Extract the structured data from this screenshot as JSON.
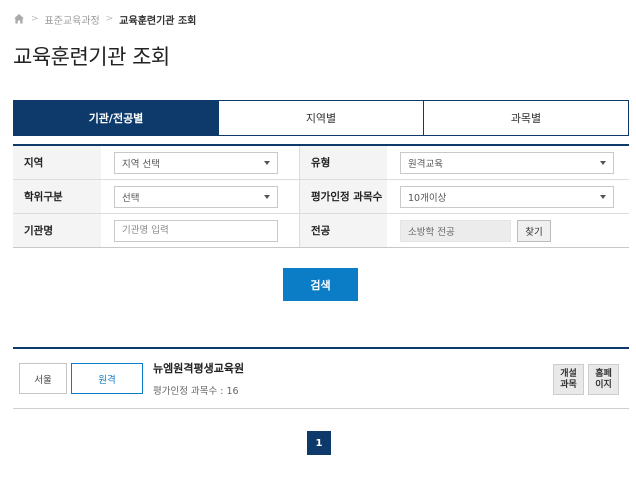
{
  "breadcrumb": {
    "items": [
      "표준교육과정",
      "교육훈련기관 조회"
    ]
  },
  "page_title": "교육훈련기관 조회",
  "tabs": [
    {
      "label": "기관/전공별",
      "active": true
    },
    {
      "label": "지역별",
      "active": false
    },
    {
      "label": "과목별",
      "active": false
    }
  ],
  "form": {
    "region": {
      "label": "지역",
      "value": "지역 선택"
    },
    "type": {
      "label": "유형",
      "value": "원격교육"
    },
    "degree": {
      "label": "학위구분",
      "value": "선택"
    },
    "accredited": {
      "label": "평가인정 과목수",
      "value": "10개이상"
    },
    "org_name": {
      "label": "기관명",
      "placeholder": "기관명 입력"
    },
    "major": {
      "label": "전공",
      "value": "소방학 전공",
      "find_label": "찾기"
    }
  },
  "search_label": "검색",
  "results": [
    {
      "region": "서울",
      "type": "원격",
      "name": "뉴엠원격평생교육원",
      "count_text": "평가인정 과목수 : 16",
      "btn_course": "개설\n과목",
      "btn_home": "홈페\n이지"
    }
  ],
  "pagination": {
    "current": "1"
  },
  "colors": {
    "navy": "#0d3a6a",
    "accent_blue": "#0b7dc6"
  }
}
